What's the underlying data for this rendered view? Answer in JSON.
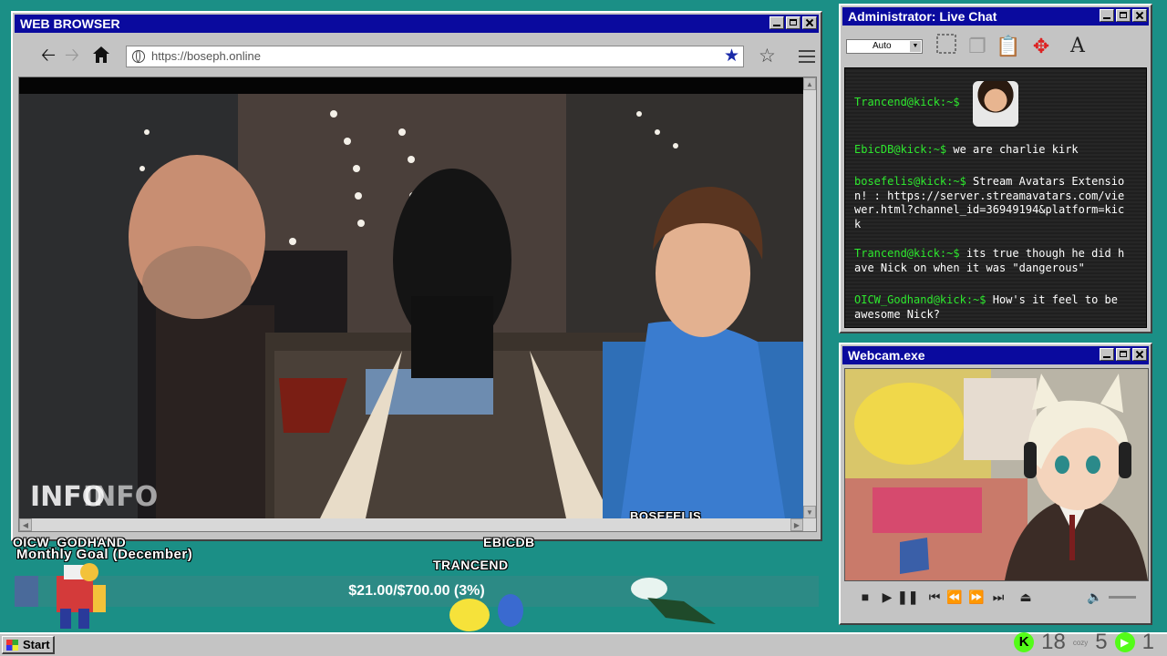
{
  "browser": {
    "title": "WEB BROWSER",
    "url": "https://boseph.online",
    "watermark": "BOSEFELIS"
  },
  "chat": {
    "title": "Administrator: Live Chat",
    "font_select": "Auto",
    "messages": [
      {
        "user": "Trancend@kick:~$",
        "text": ""
      },
      {
        "user": "EbicDB@kick:~$",
        "text": " we are charlie kirk"
      },
      {
        "user": "bosefelis@kick:~$",
        "text": " Stream Avatars Extension! : https://server.streamavatars.com/viewer.html?channel_id=36949194&platform=kick"
      },
      {
        "user": "Trancend@kick:~$",
        "text": " its true though he did have Nick on when it was \"dangerous\""
      },
      {
        "user": "OICW_Godhand@kick:~$",
        "text": " How's it feel to be awesome Nick?"
      }
    ]
  },
  "webcam": {
    "title": "Webcam.exe"
  },
  "overlay": {
    "avatar_names": [
      "OICW_GODHAND",
      "EBICDB",
      "TRANCEND"
    ],
    "goal_label": "Monthly Goal (December)",
    "goal_text": "$21.00/$700.00 (3%)",
    "goal_progress": 0.03
  },
  "taskbar": {
    "start_label": "Start",
    "tray_left": "18",
    "tray_cozy": "cozy",
    "tray_right": "5",
    "tray_last": "1"
  }
}
